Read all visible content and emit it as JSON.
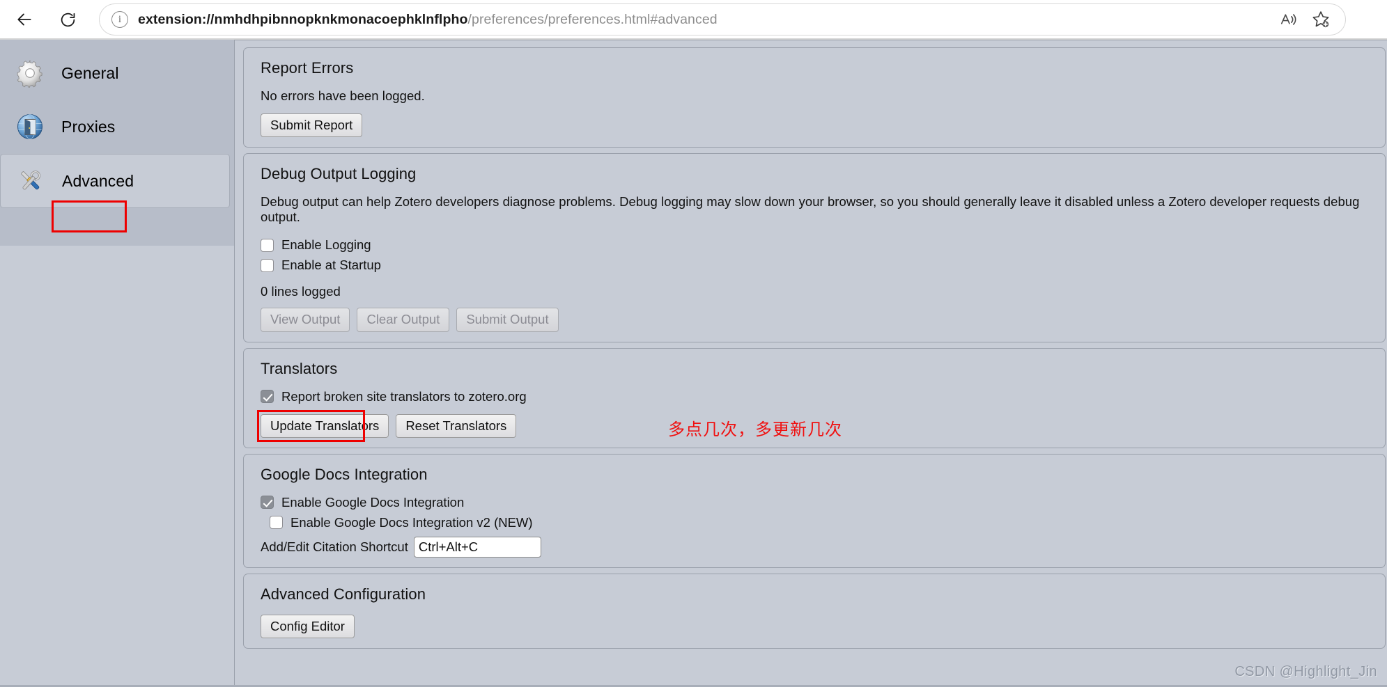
{
  "browser": {
    "back_label": "Back",
    "reload_label": "Refresh",
    "info_glyph": "i",
    "url_host": "extension://nmhdhpibnnopknkmonacoephklnflpho",
    "url_path": "/preferences/preferences.html#advanced",
    "read_aloud_label": "Read aloud",
    "favorites_label": "Add to favorites"
  },
  "sidebar": {
    "items": [
      {
        "id": "general",
        "label": "General",
        "icon": "gear-icon"
      },
      {
        "id": "proxies",
        "label": "Proxies",
        "icon": "globe-door-icon"
      },
      {
        "id": "advanced",
        "label": "Advanced",
        "icon": "tools-icon"
      }
    ]
  },
  "sections": {
    "report_errors": {
      "title": "Report Errors",
      "body": "No errors have been logged.",
      "submit_button": "Submit Report"
    },
    "debug_logging": {
      "title": "Debug Output Logging",
      "body": "Debug output can help Zotero developers diagnose problems. Debug logging may slow down your browser, so you should generally leave it disabled unless a Zotero developer requests debug output.",
      "enable_logging": {
        "label": "Enable Logging",
        "checked": false
      },
      "enable_at_startup": {
        "label": "Enable at Startup",
        "checked": false
      },
      "lines_logged": "0 lines logged",
      "view_output": "View Output",
      "clear_output": "Clear Output",
      "submit_output": "Submit Output",
      "buttons_disabled": true
    },
    "translators": {
      "title": "Translators",
      "report_broken": {
        "label": "Report broken site translators to zotero.org",
        "checked": true
      },
      "update_button": "Update Translators",
      "reset_button": "Reset Translators",
      "annotation": "多点几次，多更新几次"
    },
    "google_docs": {
      "title": "Google Docs Integration",
      "enable": {
        "label": "Enable Google Docs Integration",
        "checked": true
      },
      "enable_v2": {
        "label": "Enable Google Docs Integration v2 (NEW)",
        "checked": false
      },
      "shortcut_label": "Add/Edit Citation Shortcut",
      "shortcut_value": "Ctrl+Alt+C"
    },
    "advanced_config": {
      "title": "Advanced Configuration",
      "config_editor_button": "Config Editor"
    }
  },
  "watermark": "CSDN @Highlight_Jin",
  "colors": {
    "annotation_red": "#ee0000",
    "page_bg": "#c7ccd6",
    "sidebar_bg": "#b7bdc9"
  }
}
